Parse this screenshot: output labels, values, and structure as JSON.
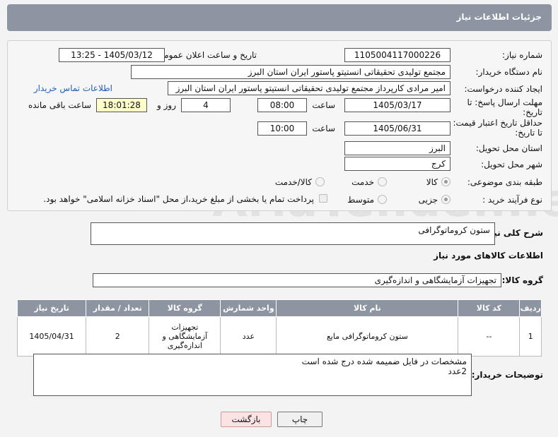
{
  "header": {
    "title": "جزئیات اطلاعات نیاز"
  },
  "form": {
    "need_number_label": "شماره نیاز:",
    "need_number": "1105004117000226",
    "announce_label": "تاریخ و ساعت اعلان عمومی:",
    "announce_value": "1405/03/12 - 13:25",
    "buyer_org_label": "نام دستگاه خریدار:",
    "buyer_org": "مجتمع تولیدی تحقیقاتی انستیتو پاستور ایران استان البرز",
    "requester_label": "ایجاد کننده درخواست:",
    "requester": "امیر مرادی کارپرداز مجتمع تولیدی تحقیقاتی انستیتو پاستور ایران استان البرز",
    "contact_link": "اطلاعات تماس خریدار",
    "deadline_label_1": "مهلت ارسال پاسخ: تا",
    "deadline_label_2": "تاریخ:",
    "deadline_date": "1405/03/17",
    "time_label": "ساعت",
    "deadline_time": "08:00",
    "days_value": "4",
    "days_label": "روز و",
    "remaining_time": "18:01:28",
    "remaining_label": "ساعت باقی مانده",
    "price_validity_label_1": "حداقل تاریخ اعتبار قیمت:",
    "price_validity_label_2": "تا تاریخ:",
    "price_validity_date": "1405/06/31",
    "price_validity_time": "10:00",
    "province_label": "استان محل تحویل:",
    "province": "البرز",
    "city_label": "شهر محل تحویل:",
    "city": "کرج",
    "category_label": "طبقه بندی موضوعی:",
    "category_options": [
      "کالا",
      "خدمت",
      "کالا/خدمت"
    ],
    "process_label": "نوع فرآیند خرید :",
    "process_options": [
      "جزیی",
      "متوسط"
    ],
    "payment_note": "پرداخت تمام یا بخشی از مبلغ خرید،از محل \"اسناد خزانه اسلامی\" خواهد بود."
  },
  "summary": {
    "label": "شرح کلی نیاز:",
    "value": "ستون کروماتوگرافی"
  },
  "goods_info_title": "اطلاعات کالاهای مورد نیاز",
  "goods_group": {
    "label": "گروه کالا:",
    "value": "تجهیزات آزمایشگاهی و اندازه‌گیری"
  },
  "table": {
    "headers": [
      "ردیف",
      "کد کالا",
      "نام کالا",
      "واحد شمارش",
      "گروه کالا",
      "تعداد / مقدار",
      "تاریخ نیاز"
    ],
    "rows": [
      [
        "1",
        "--",
        "ستون کروماتوگرافی مایع",
        "عدد",
        "تجهیزات آزمایشگاهی و اندازه‌گیری",
        "2",
        "1405/04/31"
      ]
    ]
  },
  "buyer_notes": {
    "label": "توضیحات خریدار:",
    "value": "مشخصات در فایل ضمیمه شده درج شده است\n2عدد"
  },
  "buttons": {
    "print": "چاپ",
    "back": "بازگشت"
  },
  "watermark": "AriaTender.net"
}
